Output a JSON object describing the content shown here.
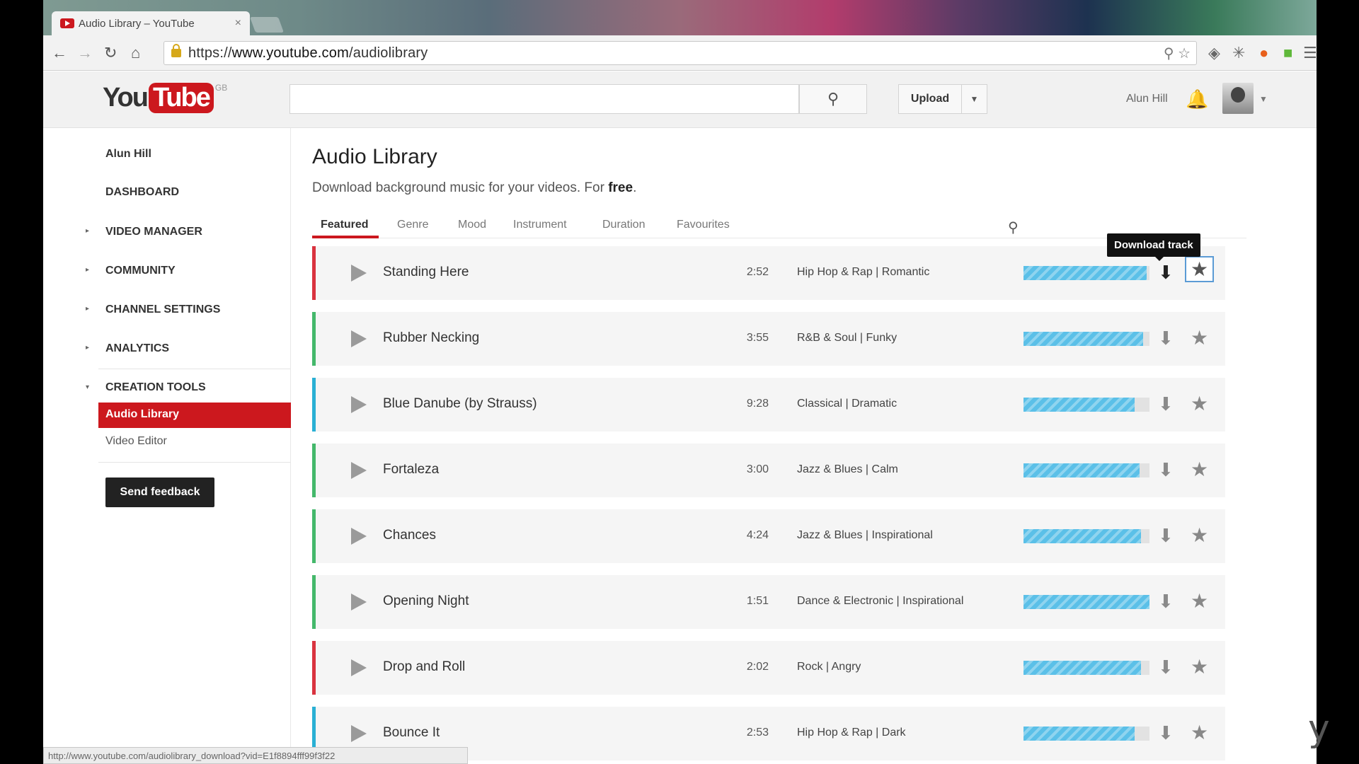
{
  "browser": {
    "tab_title": "Audio Library – YouTube",
    "tab_close": "×",
    "url_scheme": "https://",
    "url_host": "www.youtube.com",
    "url_path": "/audiolibrary",
    "status_url": "http://www.youtube.com/audiolibrary_download?vid=E1f8894fff99f3f22"
  },
  "header": {
    "logo_you": "You",
    "logo_tube": "Tube",
    "logo_region": "GB",
    "upload_label": "Upload",
    "user_name": "Alun Hill"
  },
  "sidebar": {
    "user": "Alun Hill",
    "dashboard": "DASHBOARD",
    "video_manager": "VIDEO MANAGER",
    "community": "COMMUNITY",
    "channel_settings": "CHANNEL SETTINGS",
    "analytics": "ANALYTICS",
    "creation_tools": "CREATION TOOLS",
    "audio_library": "Audio Library",
    "video_editor": "Video Editor",
    "feedback": "Send feedback"
  },
  "main": {
    "title": "Audio Library",
    "subtitle": "Download background music for your videos. For ",
    "subtitle_bold": "free",
    "subtitle_end": ".",
    "tabs": [
      "Featured",
      "Genre",
      "Mood",
      "Instrument",
      "Duration",
      "Favourites"
    ],
    "tooltip": "Download track"
  },
  "tracks": [
    {
      "name": "Standing Here",
      "duration": "2:52",
      "genre": "Hip Hop & Rap | Romantic",
      "color": "#d9333f",
      "progress": 0.98
    },
    {
      "name": "Rubber Necking",
      "duration": "3:55",
      "genre": "R&B & Soul | Funky",
      "color": "#44b86b",
      "progress": 0.95
    },
    {
      "name": "Blue Danube (by Strauss)",
      "duration": "9:28",
      "genre": "Classical | Dramatic",
      "color": "#2ab0d4",
      "progress": 0.88
    },
    {
      "name": "Fortaleza",
      "duration": "3:00",
      "genre": "Jazz & Blues | Calm",
      "color": "#44b86b",
      "progress": 0.92
    },
    {
      "name": "Chances",
      "duration": "4:24",
      "genre": "Jazz & Blues | Inspirational",
      "color": "#44b86b",
      "progress": 0.93
    },
    {
      "name": "Opening Night",
      "duration": "1:51",
      "genre": "Dance & Electronic | Inspirational",
      "color": "#44b86b",
      "progress": 1.0
    },
    {
      "name": "Drop and Roll",
      "duration": "2:02",
      "genre": "Rock | Angry",
      "color": "#d9333f",
      "progress": 0.93
    },
    {
      "name": "Bounce It",
      "duration": "2:53",
      "genre": "Hip Hop & Rap | Dark",
      "color": "#2ab0d4",
      "progress": 0.88
    }
  ]
}
